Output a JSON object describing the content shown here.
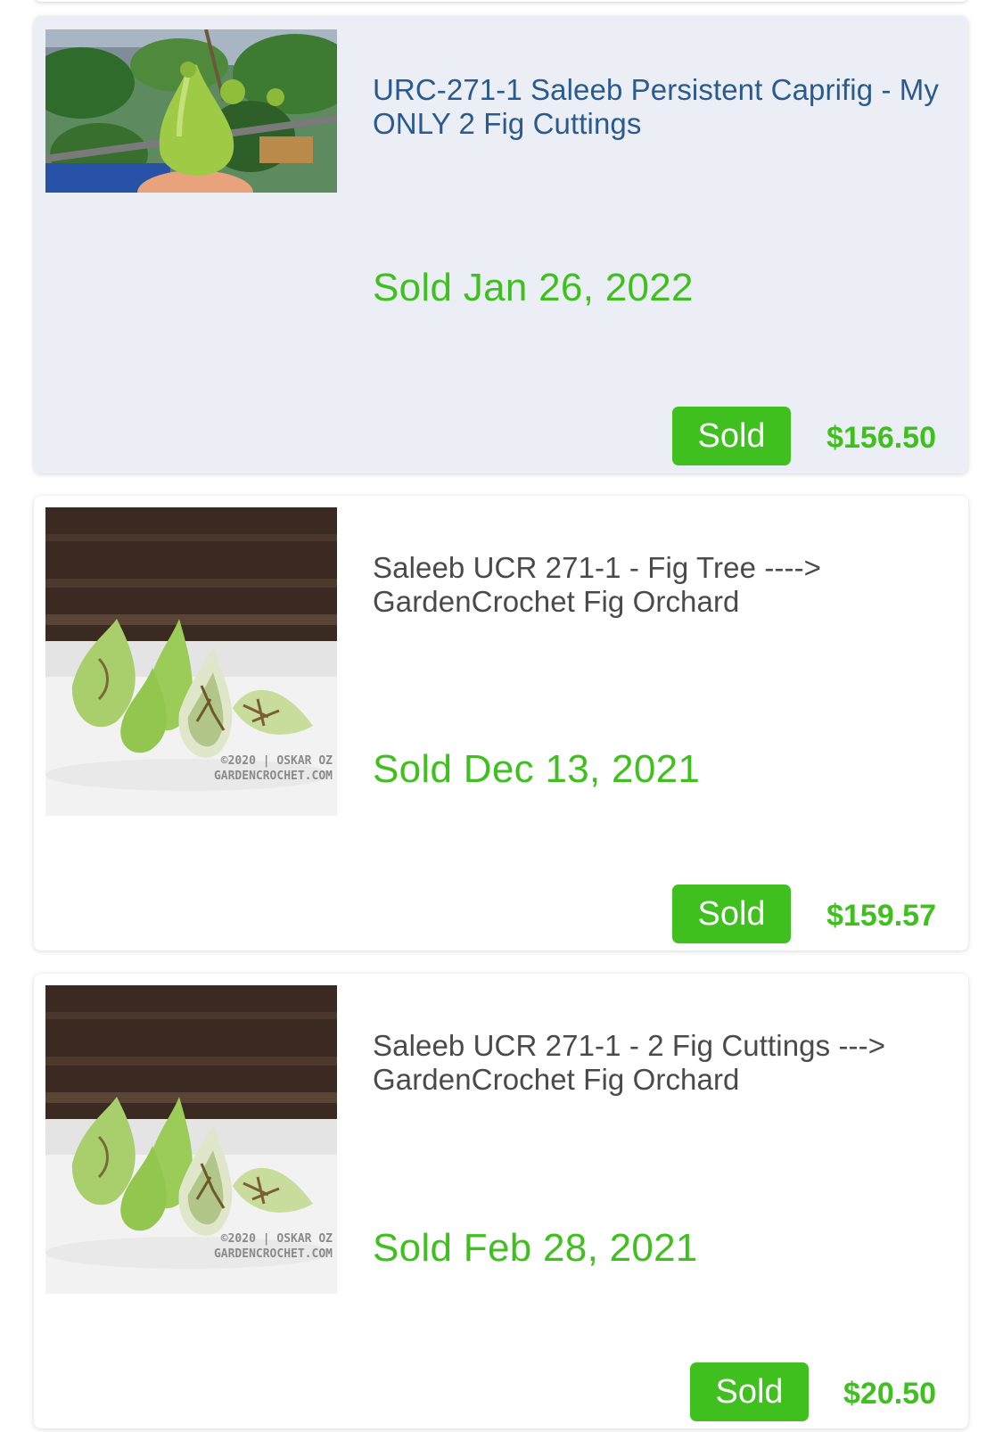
{
  "listings": [
    {
      "title": "URC-271-1 Saleeb Persistent Caprifig - My ONLY 2 Fig Cuttings",
      "sold_date": "Sold Jan 26, 2022",
      "status": "Sold",
      "price": "$156.50",
      "image_icon": "fig-on-tree-photo"
    },
    {
      "title": "Saleeb UCR 271-1 - Fig Tree ----> GardenCrochet Fig Orchard",
      "sold_date": "Sold Dec 13, 2021",
      "status": "Sold",
      "price": "$159.57",
      "image_icon": "cut-figs-photo",
      "watermark": [
        "©2020 | OSKAR OZ",
        "GARDENCROCHET.COM"
      ]
    },
    {
      "title": "Saleeb UCR 271-1 - 2 Fig Cuttings ---> GardenCrochet Fig Orchard",
      "sold_date": "Sold Feb 28, 2021",
      "status": "Sold",
      "price": "$20.50",
      "image_icon": "cut-figs-photo",
      "watermark": [
        "©2020 | OSKAR OZ",
        "GARDENCROCHET.COM"
      ]
    }
  ],
  "colors": {
    "accent_green": "#3fc01f",
    "link_blue": "#2a5a8e",
    "highlight_bg": "#ebeef4"
  }
}
